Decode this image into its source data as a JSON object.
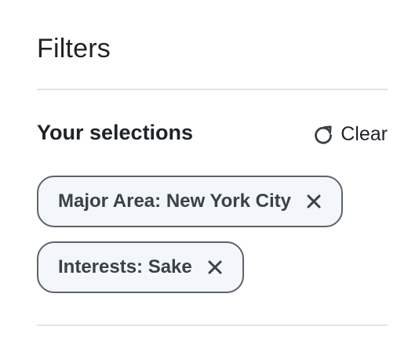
{
  "filters": {
    "title": "Filters",
    "selections_heading": "Your selections",
    "clear": {
      "label": "Clear",
      "icon": "refresh-icon"
    },
    "chips": [
      {
        "label": "Major Area: New York City",
        "icon": "close-icon"
      },
      {
        "label": "Interests: Sake",
        "icon": "close-icon"
      }
    ]
  },
  "colors": {
    "text": "#1f2328",
    "chip_bg": "#f3f7fb",
    "chip_border": "#5f6368",
    "divider": "#e3e3e3"
  }
}
